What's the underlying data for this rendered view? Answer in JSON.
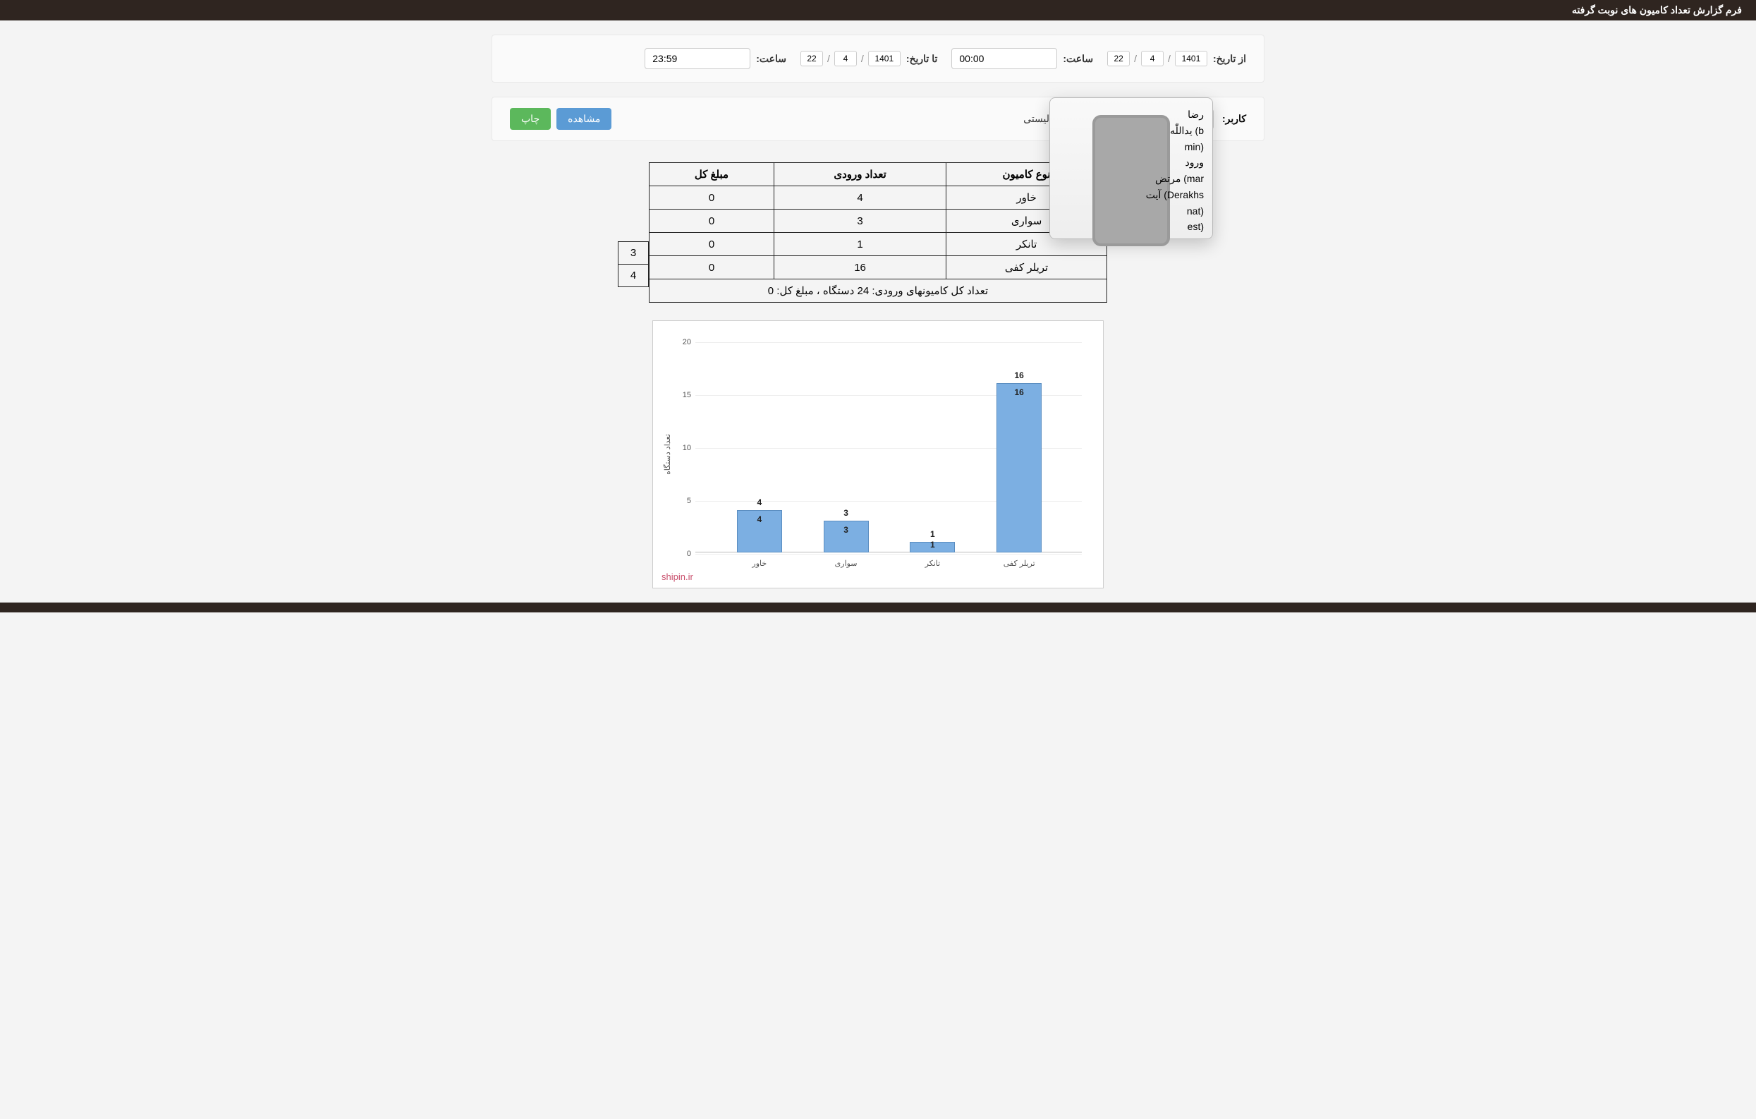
{
  "header": {
    "title": "فرم گزارش تعداد کامیون های نوبت گرفته"
  },
  "filters": {
    "from_date_label": "از تاریخ:",
    "to_date_label": "تا تاریخ:",
    "time_label": "ساعت:",
    "from_date": {
      "d": "22",
      "m": "4",
      "y": "1401"
    },
    "to_date": {
      "d": "22",
      "m": "4",
      "y": "1401"
    },
    "from_time": "00:00",
    "to_time": "23:59"
  },
  "actions": {
    "user_label": "کاربر:",
    "list_report_label": "ش لیستی",
    "view_label": "مشاهده",
    "print_label": "چاپ"
  },
  "user_dropdown": {
    "items": [
      {
        "label": "",
        "checked": true
      },
      {
        "label": "رضا"
      },
      {
        "label": "یداللّٰه           (b"
      },
      {
        "label": "min)"
      },
      {
        "label": "ورود"
      },
      {
        "label": "مرتض           (mar"
      },
      {
        "label": "آیت      (Derakhs"
      },
      {
        "label": "nat)"
      },
      {
        "label": "est)"
      }
    ]
  },
  "table": {
    "headers": [
      "نوع کامیون",
      "تعداد ورودی",
      "مبلغ کل"
    ],
    "rows": [
      [
        "خاور",
        "4",
        "0"
      ],
      [
        "سواری",
        "3",
        "0"
      ],
      [
        "تانکر",
        "1",
        "0"
      ],
      [
        "تریلر کفی",
        "16",
        "0"
      ]
    ],
    "side": [
      "3",
      "4"
    ],
    "footer": "تعداد کل کامیونهای ورودی: 24 دستگاه ، مبلغ کل: 0"
  },
  "watermark": "shipin.ir",
  "chart_data": {
    "type": "bar",
    "categories": [
      "خاور",
      "سواری",
      "تانکر",
      "تریلر کفی"
    ],
    "values": [
      4,
      3,
      1,
      16
    ],
    "ylabel": "تعداد دستگاه",
    "ylim": [
      0,
      20
    ],
    "yticks": [
      0,
      5,
      10,
      15,
      20
    ]
  }
}
